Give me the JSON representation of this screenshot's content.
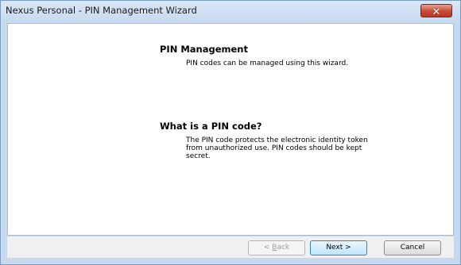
{
  "window": {
    "title": "Nexus Personal - PIN Management Wizard",
    "close_label": "✕"
  },
  "content": {
    "section1": {
      "heading": "PIN Management",
      "text": "PIN codes can be managed using this wizard."
    },
    "section2": {
      "heading": "What is a PIN code?",
      "text_lines": [
        "The PIN code protects the electronic identity token",
        "from unauthorized use. PIN codes should be kept",
        "secret."
      ]
    }
  },
  "buttons": {
    "back": {
      "prefix": "< ",
      "mnemonic": "B",
      "rest": "ack"
    },
    "next": "Next >",
    "cancel": "Cancel"
  },
  "colors": {
    "title_bar": "#c6d9ef",
    "close_button": "#c74a33"
  }
}
